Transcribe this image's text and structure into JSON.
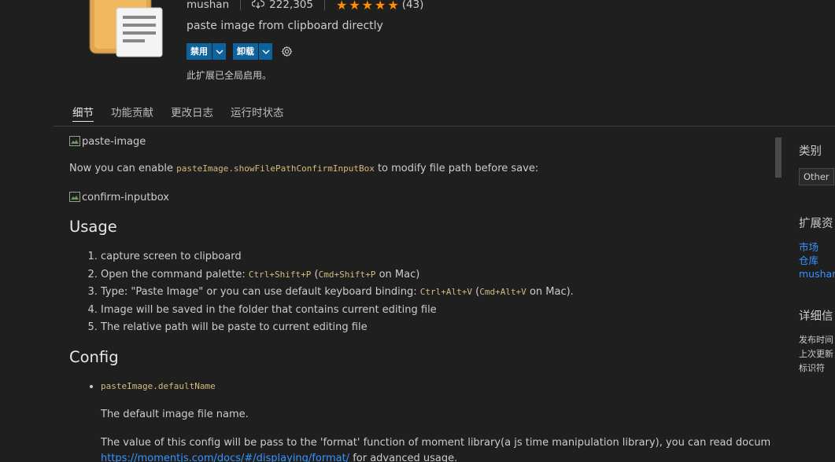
{
  "extension": {
    "publisher": "mushan",
    "install_count": "222,305",
    "rating_count": "(43)",
    "rating": 5,
    "description": "paste image from clipboard directly",
    "status_text": "此扩展已全局启用。",
    "buttons": {
      "disable_label": "禁用",
      "uninstall_label": "卸载"
    }
  },
  "tabs": [
    {
      "label": "细节",
      "active": true
    },
    {
      "label": "功能贡献",
      "active": false
    },
    {
      "label": "更改日志",
      "active": false
    },
    {
      "label": "运行时状态",
      "active": false
    }
  ],
  "readme": {
    "img1_alt": "paste-image",
    "enable_text_before": "Now you can enable ",
    "enable_code": "pasteImage.showFilePathConfirmInputBox",
    "enable_text_after": " to modify file path before save:",
    "img2_alt": "confirm-inputbox",
    "usage_heading": "Usage",
    "usage_items": {
      "item1": "capture screen to clipboard",
      "item2_text": "Open the command palette: ",
      "item2_code1": "Ctrl+Shift+P",
      "item2_mid": " (",
      "item2_code2": "Cmd+Shift+P",
      "item2_end": " on Mac)",
      "item3_text": "Type: \"Paste Image\" or you can use default keyboard binding: ",
      "item3_code1": "Ctrl+Alt+V",
      "item3_mid": " (",
      "item3_code2": "Cmd+Alt+V",
      "item3_end": " on Mac).",
      "item4": "Image will be saved in the folder that contains current editing file",
      "item5": "The relative path will be paste to current editing file"
    },
    "config_heading": "Config",
    "config_item_code": "pasteImage.defaultName",
    "config_desc": "The default image file name.",
    "config_detail": "The value of this config will be pass to the 'format' function of moment library(a js time manipulation library), you can read document",
    "config_link": "https://momentjs.com/docs/#/displaying/format/",
    "config_link_after": " for advanced usage."
  },
  "sidebar": {
    "categories_heading": "类别",
    "category_tag": "Other",
    "resources_heading": "扩展资",
    "resource_links": [
      "市场",
      "仓库",
      "mushan"
    ],
    "details_heading": "详细信",
    "detail_labels": [
      "发布时间",
      "上次更新",
      "标识符"
    ]
  },
  "colors": {
    "background": "#1f1f1f",
    "accent_button": "#0e639c",
    "star": "#ff8e00",
    "link": "#3794ff",
    "code": "#d7ba7d"
  },
  "icons": {
    "extension_icon": "clipboard-document-icon",
    "downloads": "cloud-download-icon",
    "star": "star-icon",
    "dropdown": "chevron-down-icon",
    "settings": "gear-icon",
    "broken_image": "broken-image-icon"
  }
}
